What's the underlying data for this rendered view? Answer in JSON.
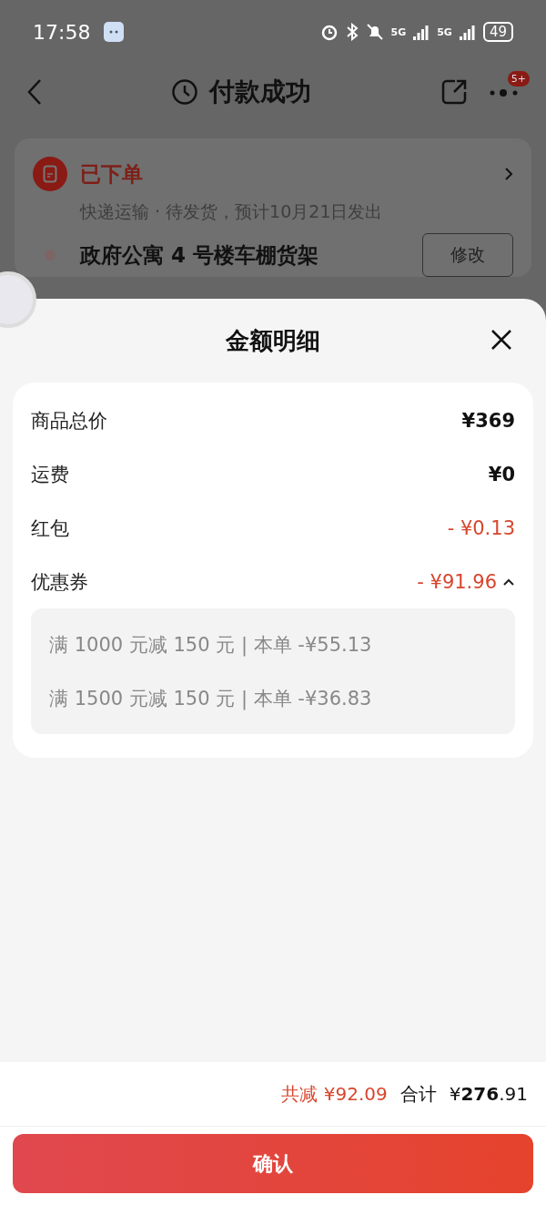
{
  "status_bar": {
    "time": "17:58",
    "network_labels": [
      "5G",
      "5G"
    ],
    "battery": "49"
  },
  "nav": {
    "title": "付款成功",
    "badge": "5+"
  },
  "order": {
    "status": "已下单",
    "tracking": "快递运输 · 待发货，预计10月21日发出",
    "address": "政府公寓 4 号楼车棚货架",
    "edit_button": "修改"
  },
  "sheet": {
    "title": "金额明细",
    "rows": [
      {
        "label": "商品总价",
        "value": "¥369",
        "kind": "plain"
      },
      {
        "label": "运费",
        "value": "¥0",
        "kind": "plain"
      },
      {
        "label": "红包",
        "value": "- ¥0.13",
        "kind": "discount"
      },
      {
        "label": "优惠券",
        "value": "- ¥91.96",
        "kind": "discount",
        "expanded": true,
        "details": [
          "满 1000 元减 150 元 | 本单 -¥55.13",
          "满 1500 元减 150 元 | 本单 -¥36.83"
        ]
      }
    ]
  },
  "footer": {
    "saved": "共减 ¥92.09",
    "total_label": "合计",
    "total": "¥**276**.91",
    "confirm": "确认"
  }
}
